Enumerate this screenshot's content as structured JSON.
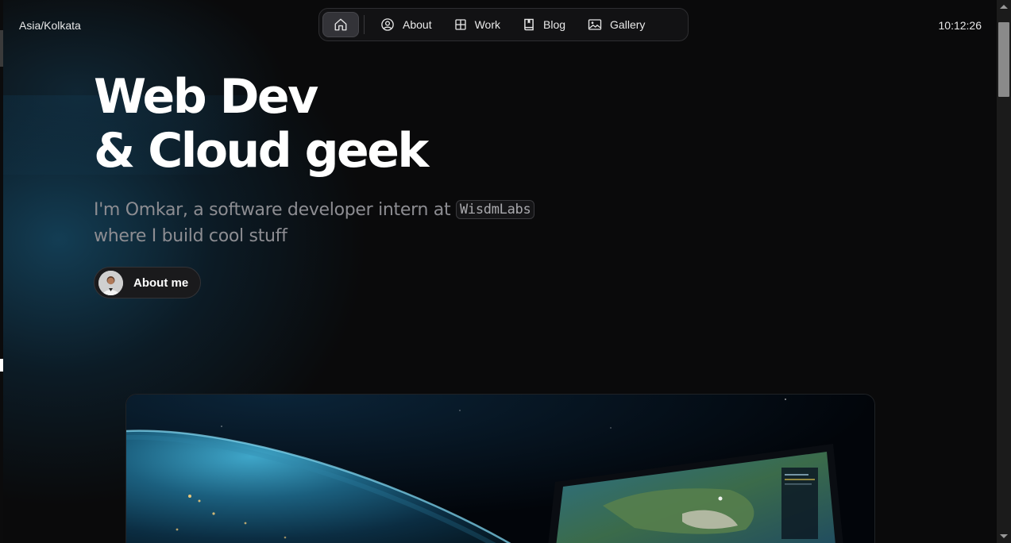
{
  "header": {
    "timezone": "Asia/Kolkata",
    "clock": "10:12:26"
  },
  "nav": {
    "home_icon": "home-icon",
    "items": [
      {
        "label": "About",
        "icon": "person-circle-icon"
      },
      {
        "label": "Work",
        "icon": "grid-icon"
      },
      {
        "label": "Blog",
        "icon": "book-icon"
      },
      {
        "label": "Gallery",
        "icon": "image-icon"
      }
    ]
  },
  "hero": {
    "title_line1": "Web Dev",
    "title_line2": "& Cloud geek",
    "subtitle_before": "I'm Omkar, a software developer intern at ",
    "company": "WisdmLabs",
    "subtitle_after": "where I build cool stuff",
    "about_button": "About me"
  },
  "colors": {
    "background": "#0a0a0b",
    "glow": "#164e6c",
    "text_muted": "#8d8d92"
  }
}
